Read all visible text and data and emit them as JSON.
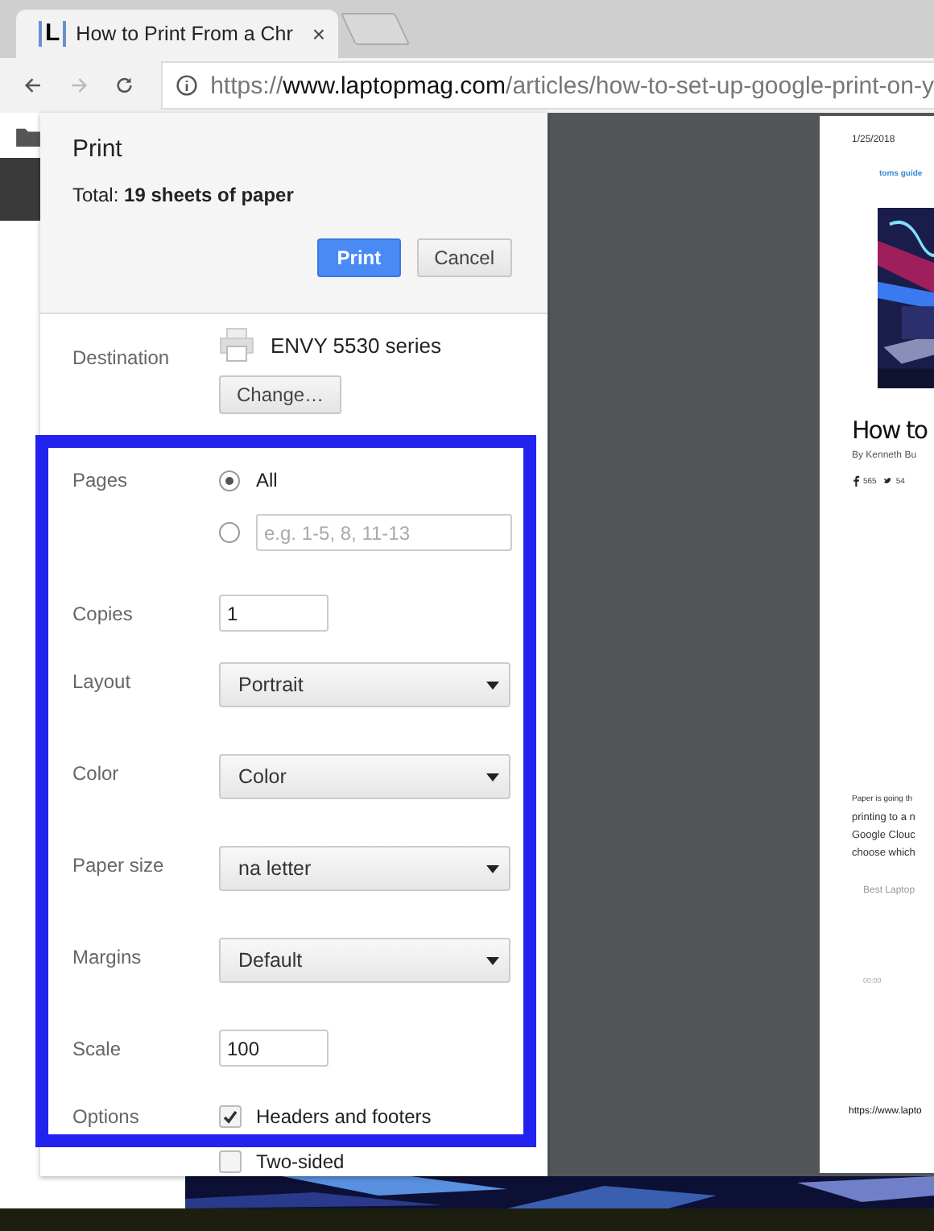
{
  "browser": {
    "tab": {
      "favicon": "L",
      "title": "How to Print From a Chr",
      "close": "×"
    },
    "address": {
      "scheme": "https://",
      "domain": "www.laptopmag.com",
      "path": "/articles/how-to-set-up-google-print-on-y"
    }
  },
  "dialog": {
    "title": "Print",
    "total_label": "Total:",
    "total_value": "19 sheets of paper",
    "buttons": [
      {
        "label": "Print",
        "kind": "primary"
      },
      {
        "label": "Cancel",
        "kind": "secondary"
      }
    ],
    "destination": {
      "label": "Destination",
      "printer": "ENVY 5530 series",
      "change": "Change…"
    },
    "settings": [
      {
        "kind": "radios",
        "label": "Pages",
        "options": [
          {
            "text": "All",
            "selected": true
          },
          {
            "placeholder": "e.g. 1-5, 8, 11-13",
            "selected": false
          }
        ]
      },
      {
        "kind": "input",
        "label": "Copies",
        "value": "1"
      },
      {
        "kind": "select",
        "label": "Layout",
        "value": "Portrait"
      },
      {
        "kind": "select",
        "label": "Color",
        "value": "Color"
      },
      {
        "kind": "select",
        "label": "Paper size",
        "value": "na letter"
      },
      {
        "kind": "select",
        "label": "Margins",
        "value": "Default"
      },
      {
        "kind": "input",
        "label": "Scale",
        "value": "100"
      },
      {
        "kind": "checks",
        "label": "Options",
        "options": [
          {
            "text": "Headers and footers",
            "checked": true
          },
          {
            "text": "Two-sided",
            "checked": false
          }
        ]
      }
    ]
  },
  "preview": {
    "date": "1/25/2018",
    "site": "toms guide",
    "headline": "How to",
    "byline": "By Kenneth Bu",
    "shares": [
      "565",
      "54"
    ],
    "paragraph": [
      "Paper is going th",
      "printing to a n",
      "Google Clouc",
      "choose which"
    ],
    "related": "Best Laptop",
    "time": "00:00",
    "footer_url": "https://www.lapto"
  }
}
